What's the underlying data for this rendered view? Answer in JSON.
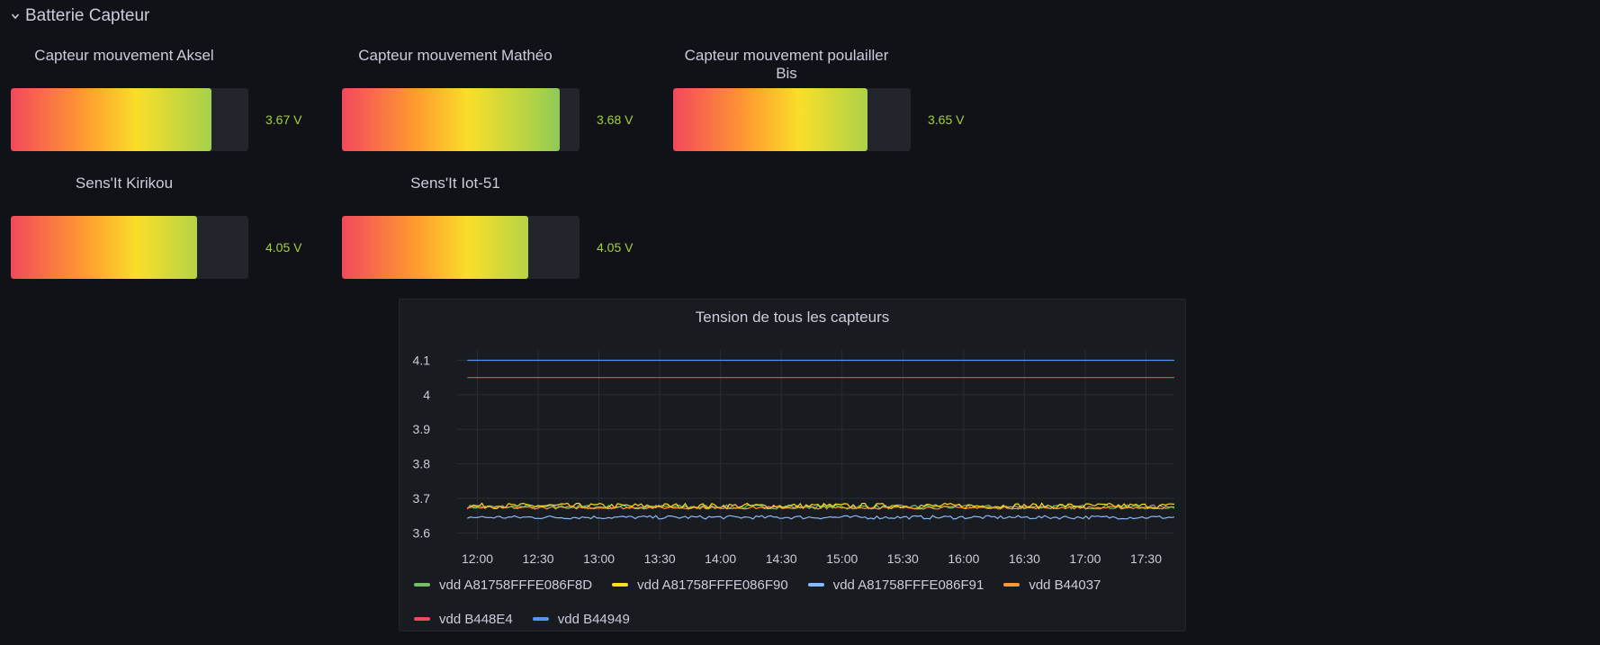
{
  "row": {
    "title": "Batterie Capteur",
    "icon": "chevron-down-icon"
  },
  "gauges": [
    {
      "title": "Capteur mouvement Aksel",
      "value": "3.67 V",
      "fraction": 0.845
    },
    {
      "title": "Capteur mouvement Mathéo",
      "value": "3.68 V",
      "fraction": 0.915
    },
    {
      "title": "Capteur mouvement poulailler Bis",
      "value": "3.65 V",
      "fraction": 0.82
    },
    {
      "title": "Sens'It Kirikou",
      "value": "4.05 V",
      "fraction": 0.785
    },
    {
      "title": "Sens'It Iot-51",
      "value": "4.05 V",
      "fraction": 0.785
    }
  ],
  "colors": {
    "value_text": "#a4d23a",
    "track": "#22252b",
    "background": "#111217",
    "panel": "#181b1f"
  },
  "chart_panel": {
    "title": "Tension de tous les capteurs"
  },
  "chart_data": {
    "type": "line",
    "title": "Tension de tous les capteurs",
    "xlabel": "",
    "ylabel": "",
    "x_ticks": [
      "12:00",
      "12:30",
      "13:00",
      "13:30",
      "14:00",
      "14:30",
      "15:00",
      "15:30",
      "16:00",
      "16:30",
      "17:00",
      "17:30"
    ],
    "y_ticks": [
      "3.6",
      "3.7",
      "3.8",
      "3.9",
      "4",
      "4.1"
    ],
    "ylim": [
      3.58,
      4.13
    ],
    "xlim": [
      "11:50",
      "17:44"
    ],
    "grid": true,
    "legend_position": "bottom",
    "series": [
      {
        "name": "vdd A81758FFFE086F8D",
        "color": "#73bf69",
        "x_start": "11:55",
        "x_end": "17:44",
        "value": 3.675,
        "noise": 0.006
      },
      {
        "name": "vdd A81758FFFE086F90",
        "color": "#fade2a",
        "x_start": "11:55",
        "x_end": "17:44",
        "value": 3.678,
        "noise": 0.008
      },
      {
        "name": "vdd A81758FFFE086F91",
        "color": "#8ab8ff",
        "x_start": "11:55",
        "x_end": "17:44",
        "value": 3.645,
        "noise": 0.005
      },
      {
        "name": "vdd B44037",
        "color": "#ff9830",
        "x_start": "11:55",
        "x_end": "17:44",
        "value": 3.673,
        "noise": 0.004
      },
      {
        "name": "vdd B448E4",
        "color": "#f2495c",
        "x_start": "11:55",
        "x_end": "17:44",
        "value": 4.05,
        "noise": 0
      },
      {
        "name": "vdd B44949",
        "color": "#5794f2",
        "x_start": "11:55",
        "x_end": "17:44",
        "value": 4.1,
        "noise": 0
      }
    ]
  }
}
